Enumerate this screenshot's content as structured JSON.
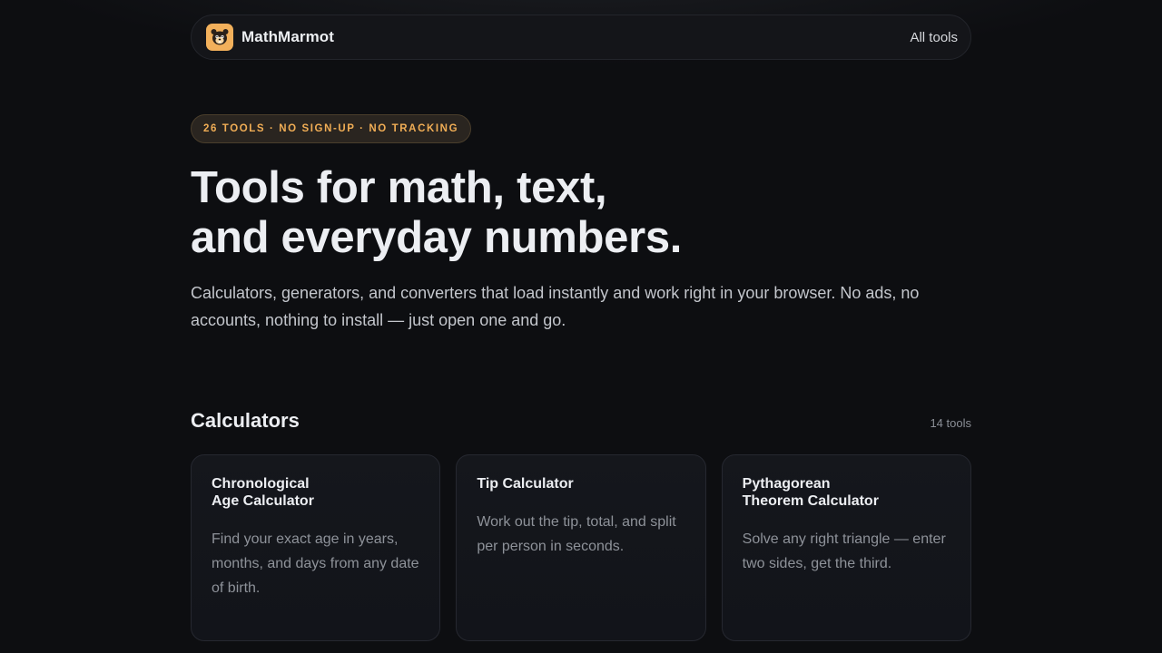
{
  "nav": {
    "brand": "MathMarmot",
    "logo_icon": "marmot-logo-icon",
    "link": "All tools"
  },
  "hero": {
    "badge": "26 TOOLS · NO SIGN-UP · NO TRACKING",
    "title_line1": "Tools for math, text,",
    "title_line2": "and everyday numbers.",
    "subtitle": "Calculators, generators, and converters that load instantly and work right in your browser. No ads, no accounts, nothing to install — just open one and go."
  },
  "section": {
    "title": "Calculators",
    "count": "14 tools"
  },
  "cards": [
    {
      "title": "Chronological\nAge Calculator",
      "desc": "Find your exact age in years, months, and days from any date of birth."
    },
    {
      "title": "Tip Calculator",
      "desc": "Work out the tip, total, and split per person in seconds."
    },
    {
      "title": "Pythagorean\nTheorem Calculator",
      "desc": "Solve any right triangle — enter two sides, get the third."
    }
  ],
  "colors": {
    "background": "#0d0e11",
    "accent": "#f0ad55",
    "logo_bg": "#f2b05b"
  }
}
